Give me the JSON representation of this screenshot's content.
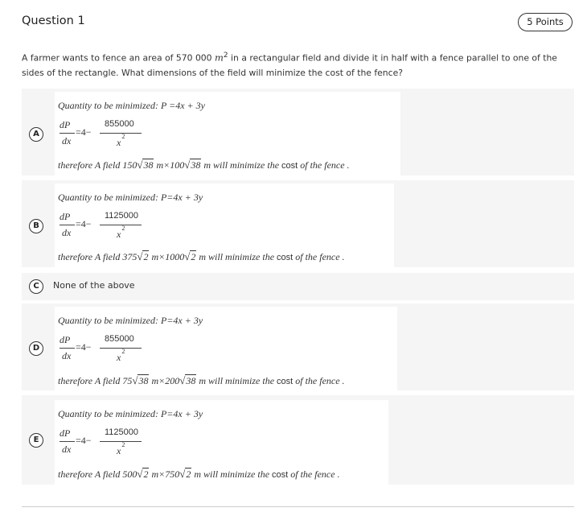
{
  "question": {
    "title": "Question 1",
    "points": "5 Points",
    "text_part1": "A farmer wants to fence an area of 570 000 ",
    "unit": "m",
    "unit_power": "2",
    "text_part2": " in a rectangular field and divide it in half with a fence parallel to one of the sides of the rectangle. What dimensions of the field will minimize the cost of the fence?"
  },
  "options": [
    {
      "letter": "A",
      "line1": "Quantity to be minimized: P =4x + 3y",
      "derivative": "dP",
      "dx": "dx",
      "eq": "=4−",
      "numerator": "855000",
      "denominator": "x",
      "den_power": "2",
      "concl_prefix": "therefore A field 150",
      "root1": "38",
      "concl_mid": " m×100",
      "root2": "38",
      "concl_mid2": " m will minimize the ",
      "cost_word": "cost",
      "concl_suffix": " of the fence ."
    },
    {
      "letter": "B",
      "line1": "Quantity to be minimized: P=4x + 3y",
      "derivative": "dP",
      "dx": "dx",
      "eq": "=4−",
      "numerator": "1125000",
      "denominator": "x",
      "den_power": "2",
      "concl_prefix": "therefore A field 375",
      "root1": "2",
      "concl_mid": " m×1000",
      "root2": "2",
      "concl_mid2": " m will minimize the ",
      "cost_word": "cost",
      "concl_suffix": " of the fence ."
    },
    {
      "letter": "C",
      "text": "None of the above"
    },
    {
      "letter": "D",
      "line1": "Quantity to be minimized: P=4x + 3y",
      "derivative": "dP",
      "dx": "dx",
      "eq": "=4−",
      "numerator": "855000",
      "denominator": "x",
      "den_power": "2",
      "concl_prefix": "therefore A field 75",
      "root1": "38",
      "concl_mid": " m×200",
      "root2": "38",
      "concl_mid2": " m will minimize the ",
      "cost_word": "cost",
      "concl_suffix": " of the fence ."
    },
    {
      "letter": "E",
      "line1": "Quantity to be minimized: P=4x + 3y",
      "derivative": "dP",
      "dx": "dx",
      "eq": "=4−",
      "numerator": "1125000",
      "denominator": "x",
      "den_power": "2",
      "concl_prefix": "therefore A field 500",
      "root1": "2",
      "concl_mid": " m×750",
      "root2": "2",
      "concl_mid2": " m will minimize the ",
      "cost_word": "cost",
      "concl_suffix": " of the fence ."
    }
  ]
}
